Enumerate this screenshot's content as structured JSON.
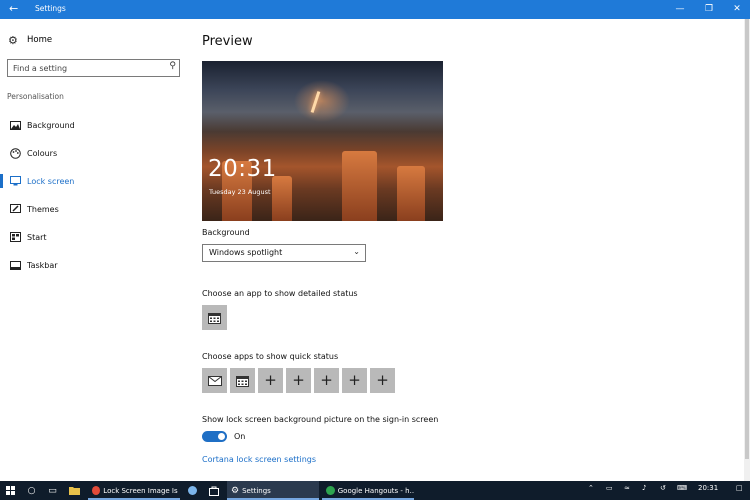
{
  "window": {
    "title": "Settings",
    "back_icon": "arrow-left-icon",
    "minimize_icon": "minimize-icon",
    "restore_icon": "restore-icon",
    "close_icon": "close-icon"
  },
  "sidebar": {
    "home_label": "Home",
    "search_placeholder": "Find a setting",
    "section_label": "Personalisation",
    "items": [
      {
        "label": "Background",
        "icon": "picture-icon",
        "active": false
      },
      {
        "label": "Colours",
        "icon": "palette-icon",
        "active": false
      },
      {
        "label": "Lock screen",
        "icon": "lock-screen-icon",
        "active": true
      },
      {
        "label": "Themes",
        "icon": "brush-icon",
        "active": false
      },
      {
        "label": "Start",
        "icon": "start-grid-icon",
        "active": false
      },
      {
        "label": "Taskbar",
        "icon": "taskbar-icon",
        "active": false
      }
    ]
  },
  "main": {
    "preview_heading": "Preview",
    "preview_time": "20:31",
    "preview_date": "Tuesday 23 August",
    "background_label": "Background",
    "background_value": "Windows spotlight",
    "detailed_status_label": "Choose an app to show detailed status",
    "quick_status_label": "Choose apps to show quick status",
    "signin_label": "Show lock screen background picture on the sign-in screen",
    "toggle_state": "On",
    "cortana_link": "Cortana lock screen settings"
  },
  "taskbar": {
    "apps": [
      {
        "label": "Lock Screen Image Is ...",
        "icon": "chrome-icon",
        "active": false
      },
      {
        "label": "Settings",
        "icon": "gear-icon",
        "active": true
      },
      {
        "label": "Google Hangouts - h...",
        "icon": "hangouts-icon",
        "active": false
      }
    ],
    "time": "20:31"
  },
  "colors": {
    "accent": "#1f7ad8",
    "link": "#1c6fc8",
    "taskbar": "#0f1c2b",
    "tile": "#b9b9b9"
  }
}
